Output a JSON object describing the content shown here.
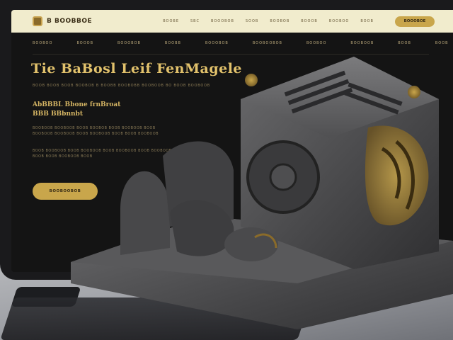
{
  "site": {
    "logo_text": "B BOOBBOE",
    "nav": [
      "BOOBE",
      "SBC",
      "BOOOBOB",
      "SOOB",
      "BOOBOB",
      "BOOOB",
      "BOOBOO",
      "BOOB"
    ],
    "cta_label": "BOOOBOE"
  },
  "subnav": [
    "BOOBOO",
    "BOOOB",
    "BOOOBOB",
    "BOOBB",
    "BOOOBOB",
    "BOOBOOBOB",
    "BOOBOO",
    "BOOBOOB",
    "BOOB",
    "BOOB"
  ],
  "hero": {
    "title": "Tie BaBosl Leif FenMagele",
    "subtitle": "BOOB BOOB BOOB BOOBOB B BOOBB BOOBOBB BOOBOOB BO BOOB BOOBOOB",
    "heading_line1": "AbBBBL Bbone frnBroat",
    "heading_line2": "BBB BBbnnbt",
    "para1": "BOOBOOB BOOBOOB BOOB BOOBOB BOOB BOOBOOB BOOB BOOBOOB BOOBOOB BOOB BOOBOOB BOOB BOOB BOOBOOB",
    "para2": "BOOB BOOBOOB BOOB BOOBOOB BOOB BOOBOOB BOOB BOOBOOB BOOB BOOB BOOBOOB BOOB",
    "button_label": "BOOBOOBOB"
  },
  "colors": {
    "accent_gold": "#c9a64b",
    "nav_bg": "#f1eccd",
    "screen_bg": "#141414",
    "sculpture_stone": "#4b4b4d"
  }
}
